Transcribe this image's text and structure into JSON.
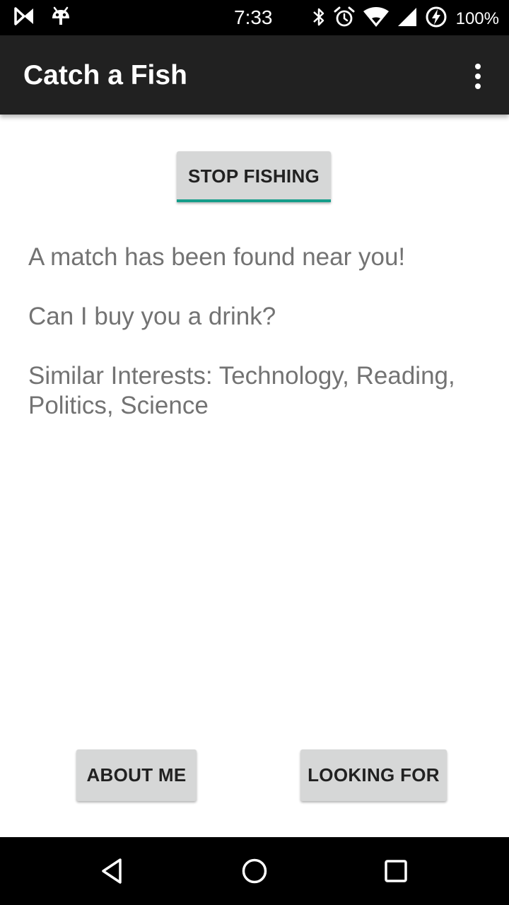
{
  "status_bar": {
    "time": "7:33",
    "battery": "100%",
    "icons": [
      "media-notification-icon",
      "android-robot-icon",
      "bluetooth-icon",
      "alarm-icon",
      "wifi-icon",
      "cell-signal-icon",
      "battery-charging-icon"
    ]
  },
  "app_bar": {
    "title": "Catch a Fish",
    "menu_icon": "overflow-menu-icon"
  },
  "main": {
    "stop_button_label": "STOP FISHING",
    "match_text": "A match has been found near you!",
    "drink_text": "Can I buy you a drink?",
    "interests_text": "Similar Interests: Technology, Reading, Politics, Science",
    "about_button_label": "ABOUT ME",
    "looking_button_label": "LOOKING FOR"
  },
  "nav_bar": {
    "icons": [
      "back-icon",
      "home-icon",
      "recents-icon"
    ]
  },
  "colors": {
    "app_bar": "#212121",
    "button_bg": "#d6d7d7",
    "accent": "#159d8a",
    "body_text": "#737373"
  }
}
